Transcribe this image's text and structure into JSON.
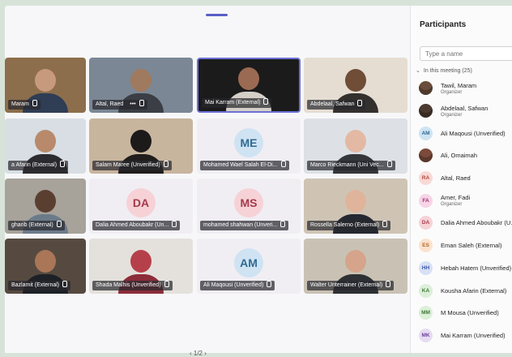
{
  "stage": {
    "tiles": [
      {
        "name": "Maram",
        "style": "photo",
        "bg": "#8c6e4c",
        "head": "#c89a7d",
        "bodyc": "#2f3d55"
      },
      {
        "name": "Altal, Raed",
        "style": "photo",
        "bg": "#7b8794",
        "head": "#a07a5e",
        "bodyc": "#3b3f45",
        "more": "•••"
      },
      {
        "name": "Mai Karram (External)",
        "style": "photo",
        "bg": "#1b1b1b",
        "head": "#9b6a52",
        "bodyc": "#d4cfc7",
        "active": true
      },
      {
        "name": "Abdelaal, Safwan",
        "style": "photo",
        "bg": "#e6ddd2",
        "head": "#6f4d36",
        "bodyc": "#33302e"
      },
      {
        "name": "a Afarin (External)",
        "style": "photo",
        "bg": "#d8dee4",
        "head": "#b88a6b",
        "bodyc": "#2c2c30"
      },
      {
        "name": "Salam Maree (Unverified)",
        "style": "photo",
        "bg": "#c8b59e",
        "head": "#1d1a1a",
        "bodyc": "#201d1c"
      },
      {
        "name": "Mohamed Wael Salah El-Di...",
        "style": "initials",
        "initials": "ME",
        "avbg": "#cfe3f2",
        "avfg": "#2f6b93"
      },
      {
        "name": "Marco Rieckmann (Uni Vec...",
        "style": "photo",
        "bg": "#dde1e5",
        "head": "#e3b9a3",
        "bodyc": "#34363a"
      },
      {
        "name": "gharib (External)",
        "style": "photo",
        "bg": "#a7a29a",
        "head": "#5a3f30",
        "bodyc": "#6c7b8a"
      },
      {
        "name": "Dalia Ahmed Aboubakr (Un...",
        "style": "initials",
        "initials": "DA",
        "avbg": "#f6d2d6",
        "avfg": "#a33b4c"
      },
      {
        "name": "mohamed shahwan (Unveri...",
        "style": "initials",
        "initials": "MS",
        "avbg": "#f6d2d6",
        "avfg": "#a33b4c"
      },
      {
        "name": "Rossella Salerno (External)",
        "style": "photo",
        "bg": "#cfc4b4",
        "head": "#dfb49b",
        "bodyc": "#252830"
      },
      {
        "name": "Bazlamit (External)",
        "style": "photo",
        "bg": "#564a40",
        "head": "#a97658",
        "bodyc": "#1d2126"
      },
      {
        "name": "Shada Malhis (Unverified)",
        "style": "photo",
        "bg": "#e4e1dc",
        "head": "#b6404a",
        "bodyc": "#8c2d3a"
      },
      {
        "name": "Ali Maqousi (Unverified)",
        "style": "initials",
        "initials": "AM",
        "avbg": "#cfe3f2",
        "avfg": "#2f6b93"
      },
      {
        "name": "Walter Unterrainer (External)",
        "style": "photo",
        "bg": "#c9c2b4",
        "head": "#d5a48a",
        "bodyc": "#2e3134"
      }
    ],
    "pager": "‹ 1/2 ›"
  },
  "panel": {
    "title": "Participants",
    "search_placeholder": "Type a name",
    "section_label": "In this meeting (25)",
    "participants": [
      {
        "name": "Tawil, Maram",
        "role": "Organizer",
        "av": "photo",
        "color": "#6a4c3c"
      },
      {
        "name": "Abdelaal, Safwan",
        "role": "Organizer",
        "av": "photo",
        "color": "#4b3a30"
      },
      {
        "name": "Ali Maqousi (Unverified)",
        "initials": "AM",
        "bg": "#cfe3f2",
        "fg": "#2f6b93"
      },
      {
        "name": "Ali, Omaimah",
        "av": "photo",
        "color": "#7a4a3a"
      },
      {
        "name": "Altal, Raed",
        "initials": "RA",
        "bg": "#f9d9d6",
        "fg": "#b24a44"
      },
      {
        "name": "Amer, Fadi",
        "role": "Organizer",
        "initials": "FA",
        "bg": "#f7d4e6",
        "fg": "#a2346d"
      },
      {
        "name": "Dalia Ahmed Aboubakr (U...",
        "initials": "DA",
        "bg": "#f6d2d6",
        "fg": "#a33b4c"
      },
      {
        "name": "Eman Saleh (External)",
        "initials": "ES",
        "bg": "#fbe3cf",
        "fg": "#b06a2c"
      },
      {
        "name": "Hebah Hatem (Unverified)",
        "initials": "HH",
        "bg": "#d8e0f5",
        "fg": "#3b55a6"
      },
      {
        "name": "Kousha Afarin (External)",
        "initials": "KA",
        "bg": "#dcefd9",
        "fg": "#3f7a35"
      },
      {
        "name": "M Mousa (Unverified)",
        "initials": "MM",
        "bg": "#dcefd9",
        "fg": "#3f7a35"
      },
      {
        "name": "Mai Karram (Unverified)",
        "initials": "MK",
        "bg": "#e6dcf2",
        "fg": "#6b3f9c"
      }
    ]
  },
  "colors": {
    "accent": "#5b5fc7",
    "background": "#d7e3d8"
  }
}
